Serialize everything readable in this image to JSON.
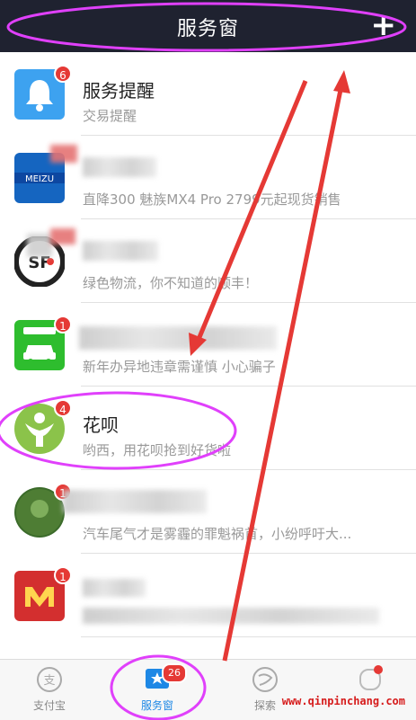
{
  "header": {
    "title": "服务窗",
    "add_icon": "plus-icon",
    "bg": "#1f2230"
  },
  "items": [
    {
      "name": "服务提醒",
      "sub": "交易提醒",
      "badge": "6",
      "icon": "bell-icon",
      "color": "#3da2f0"
    },
    {
      "name": "",
      "sub": "直降300 魅族MX4 Pro 2799元起现货销售",
      "badge": "",
      "icon": "meizu-icon",
      "color": "#1565c0"
    },
    {
      "name": "",
      "sub": "绿色物流，你不知道的顺丰！",
      "badge": "",
      "icon": "sf-icon",
      "color": "#222222"
    },
    {
      "name": "",
      "sub": "新年办异地违章需谨慎 小心骗子",
      "badge": "1",
      "icon": "car-icon",
      "color": "#2ebd2e"
    },
    {
      "name": "花呗",
      "sub": "哟西，用花呗抢到好货啦",
      "badge": "4",
      "icon": "huabei-icon",
      "color": "#8bc34a"
    },
    {
      "name": "",
      "sub": "汽车尾气才是雾霾的罪魁祸首，小纷呼吁大...",
      "badge": "1",
      "icon": "green-circle-icon",
      "color": "#3b6b2a"
    },
    {
      "name": "",
      "sub": "",
      "badge": "1",
      "icon": "m-logo-icon",
      "color": "#d32f2f"
    }
  ],
  "tabbar": {
    "tabs": [
      {
        "label": "支付宝",
        "icon": "alipay-icon"
      },
      {
        "label": "服务窗",
        "icon": "service-window-icon",
        "badge": "26"
      },
      {
        "label": "探索",
        "icon": "explore-icon"
      }
    ]
  },
  "watermark": "www.qinpinchang.com"
}
